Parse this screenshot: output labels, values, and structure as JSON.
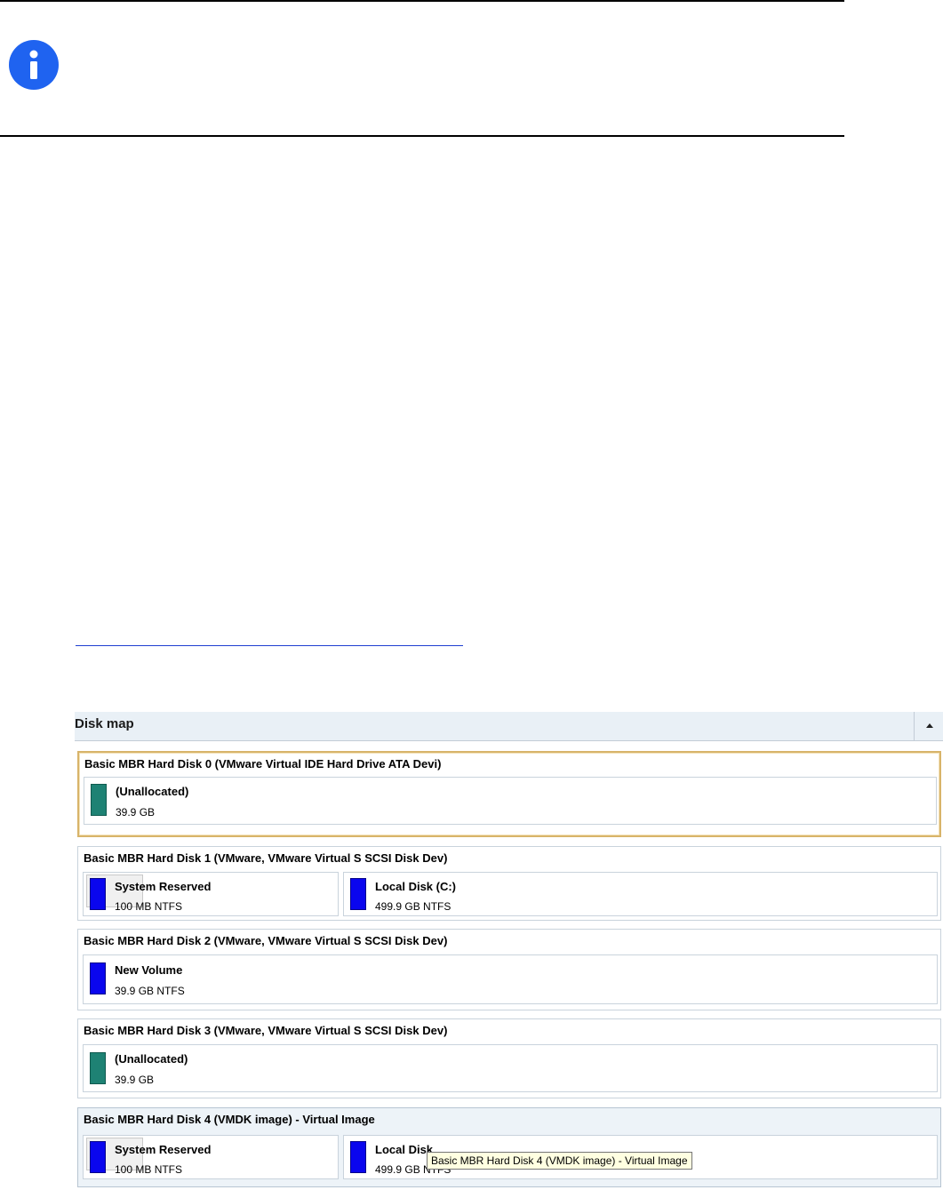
{
  "disk_map": {
    "title": "Disk map",
    "disks": [
      {
        "title": "Basic MBR Hard Disk 0 (VMware Virtual IDE Hard Drive ATA Devi)",
        "partitions": [
          {
            "name": "(Unallocated)",
            "size": "39.9 GB",
            "kind": "unallocated"
          }
        ]
      },
      {
        "title": "Basic MBR Hard Disk 1 (VMware, VMware Virtual S SCSI Disk Dev)",
        "partitions": [
          {
            "name": "System Reserved",
            "size": "100 MB NTFS",
            "kind": "ntfs"
          },
          {
            "name": "Local Disk (C:)",
            "size": "499.9 GB NTFS",
            "kind": "ntfs"
          }
        ]
      },
      {
        "title": "Basic MBR Hard Disk 2 (VMware, VMware Virtual S SCSI Disk Dev)",
        "partitions": [
          {
            "name": "New Volume",
            "size": "39.9 GB NTFS",
            "kind": "ntfs"
          }
        ]
      },
      {
        "title": "Basic MBR Hard Disk 3 (VMware, VMware Virtual S SCSI Disk Dev)",
        "partitions": [
          {
            "name": "(Unallocated)",
            "size": "39.9 GB",
            "kind": "unallocated"
          }
        ]
      },
      {
        "title": "Basic MBR Hard Disk 4 (VMDK image) - Virtual Image",
        "partitions": [
          {
            "name": "System Reserved",
            "size": "100 MB NTFS",
            "kind": "ntfs"
          },
          {
            "name": "Local Disk",
            "size": "499.9 GB NTFS",
            "kind": "ntfs"
          }
        ]
      }
    ],
    "tooltip": "Basic MBR Hard Disk 4 (VMDK image) - Virtual Image"
  },
  "colors": {
    "ntfs": "#0a06ee",
    "unallocated": "#1e8274",
    "info_icon": "#1f63f0",
    "selected_border": "#d8b46a"
  },
  "icons": {
    "info": "info-icon",
    "collapse": "chevron-up-icon"
  }
}
